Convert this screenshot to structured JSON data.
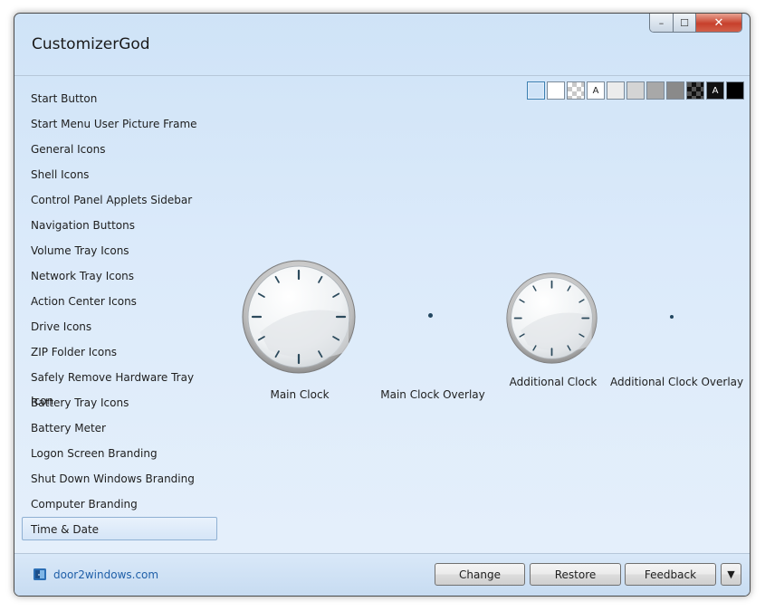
{
  "window": {
    "title": "CustomizerGod",
    "controls": {
      "minimize": "–",
      "maximize": "☐",
      "close": "✕"
    }
  },
  "sidebar": {
    "items": [
      {
        "label": "Start Button"
      },
      {
        "label": "Start Menu User Picture Frame"
      },
      {
        "label": "General Icons"
      },
      {
        "label": "Shell Icons"
      },
      {
        "label": "Control Panel Applets Sidebar"
      },
      {
        "label": "Navigation Buttons"
      },
      {
        "label": "Volume Tray Icons"
      },
      {
        "label": "Network Tray Icons"
      },
      {
        "label": "Action Center Icons"
      },
      {
        "label": "Drive Icons"
      },
      {
        "label": "ZIP Folder Icons"
      },
      {
        "label": "Safely Remove Hardware Tray Icon"
      },
      {
        "label": "Battery Tray Icons"
      },
      {
        "label": "Battery Meter"
      },
      {
        "label": "Logon Screen Branding"
      },
      {
        "label": "Shut Down Windows Branding"
      },
      {
        "label": "Computer Branding"
      },
      {
        "label": "Time & Date"
      }
    ],
    "selected_index": 17
  },
  "background_swatches": {
    "items": [
      {
        "name": "light-blue",
        "color": "#cfe3f7",
        "text": ""
      },
      {
        "name": "white",
        "color": "#ffffff",
        "text": ""
      },
      {
        "name": "checker",
        "color": "#e0e0e0",
        "text": ""
      },
      {
        "name": "white-letter",
        "color": "#ffffff",
        "text": "A"
      },
      {
        "name": "very-light-gray",
        "color": "#ececec",
        "text": ""
      },
      {
        "name": "light-gray",
        "color": "#d4d4d4",
        "text": ""
      },
      {
        "name": "gray",
        "color": "#a8a8a8",
        "text": ""
      },
      {
        "name": "mid-gray",
        "color": "#8a8a8a",
        "text": ""
      },
      {
        "name": "dark-checker",
        "color": "#333333",
        "text": ""
      },
      {
        "name": "black-letter",
        "color": "#111111",
        "text": "A"
      },
      {
        "name": "black",
        "color": "#000000",
        "text": ""
      }
    ]
  },
  "resources": {
    "main_clock": {
      "label": "Main Clock"
    },
    "main_clock_overlay": {
      "label": "Main Clock Overlay"
    },
    "additional_clock": {
      "label": "Additional Clock"
    },
    "additional_clock_overlay": {
      "label": "Additional Clock Overlay"
    }
  },
  "footer": {
    "link_text": "door2windows.com",
    "buttons": {
      "change": "Change",
      "restore": "Restore",
      "feedback": "Feedback",
      "more": "▼"
    }
  }
}
